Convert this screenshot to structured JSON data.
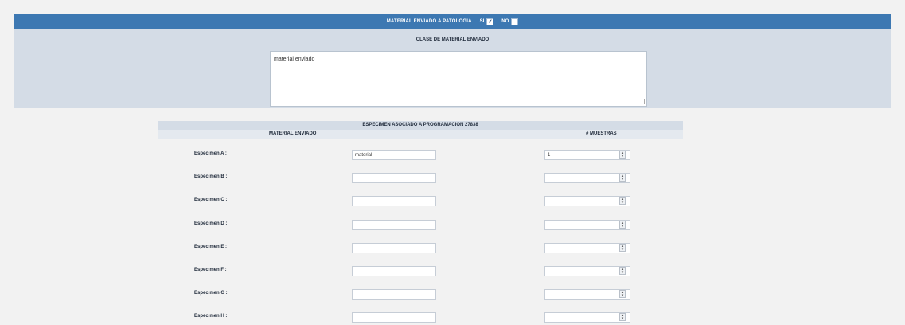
{
  "header": {
    "title": "MATERIAL ENVIADO A PATOLOGIA",
    "option_si": "SI",
    "option_no": "NO",
    "si_checked": true,
    "no_checked": false
  },
  "clase": {
    "title": "CLASE DE MATERIAL ENVIADO",
    "value": "material enviado"
  },
  "especimen": {
    "title": "ESPECIMEN ASOCIADO A PROGRAMACION 27838",
    "col_material": "MATERIAL ENVIADO",
    "col_muestras": "# MUESTRAS",
    "rows": [
      {
        "label": "Especimen A :",
        "material": "material",
        "muestras": "1"
      },
      {
        "label": "Especimen B :",
        "material": "",
        "muestras": ""
      },
      {
        "label": "Especimen C :",
        "material": "",
        "muestras": ""
      },
      {
        "label": "Especimen D :",
        "material": "",
        "muestras": ""
      },
      {
        "label": "Especimen E :",
        "material": "",
        "muestras": ""
      },
      {
        "label": "Especimen F :",
        "material": "",
        "muestras": ""
      },
      {
        "label": "Especimen G :",
        "material": "",
        "muestras": ""
      },
      {
        "label": "Especimen H :",
        "material": "",
        "muestras": ""
      }
    ]
  },
  "colors": {
    "header_bar": "#3d78b2",
    "panel": "#d4dce6",
    "background": "#f2f2f2"
  }
}
